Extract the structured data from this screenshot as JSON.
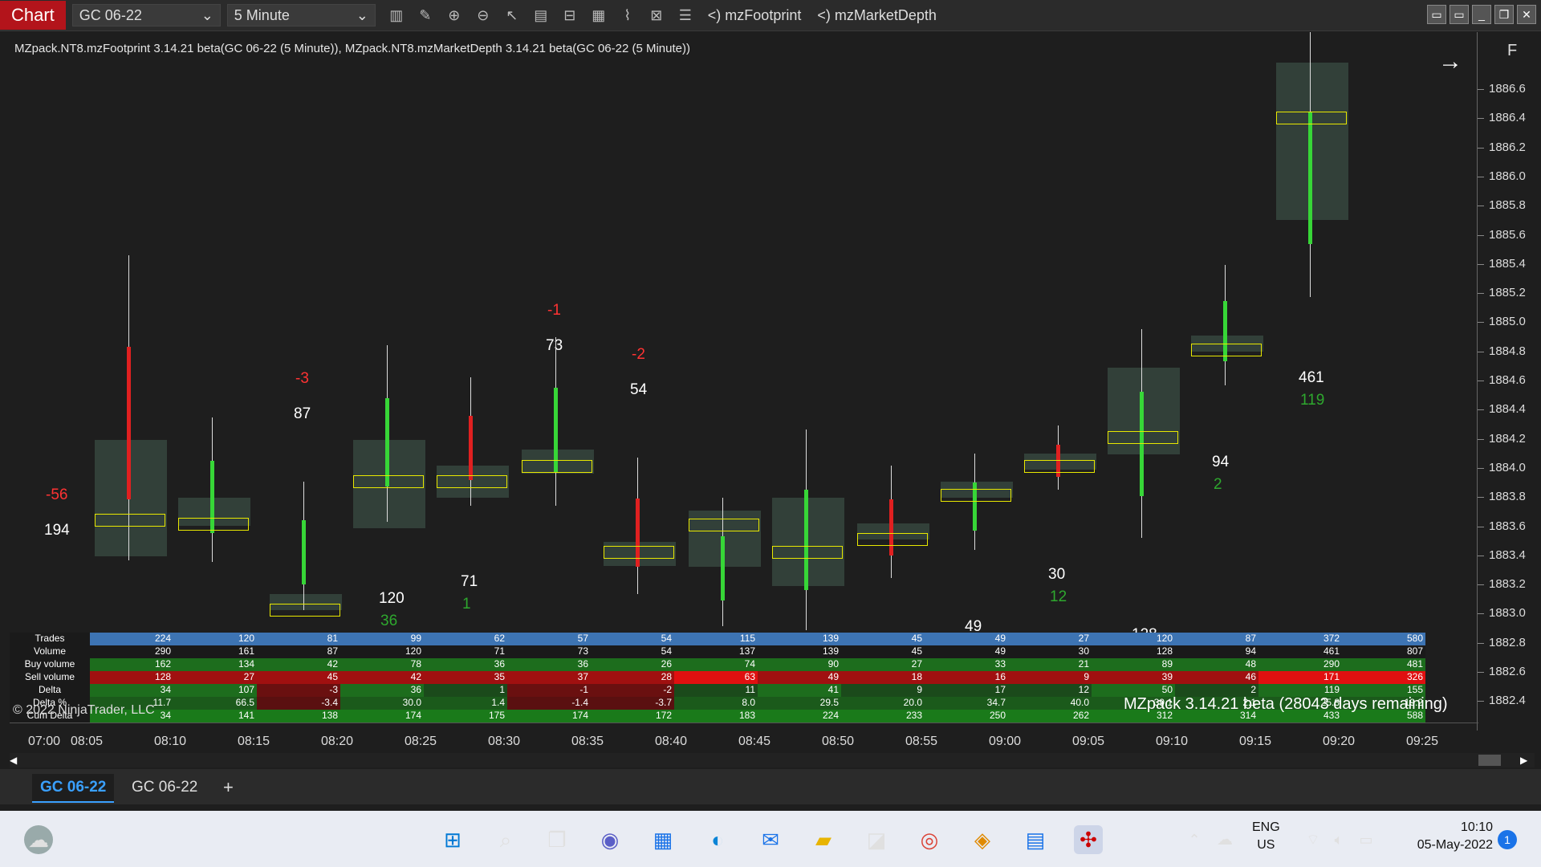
{
  "toolbar": {
    "chart_tab": "Chart",
    "instrument": "GC 06-22",
    "interval": "5 Minute",
    "indicator1": "<) mzFootprint",
    "indicator2": "<) mzMarketDepth"
  },
  "chart": {
    "title": "MZpack.NT8.mzFootprint 3.14.21 beta(GC 06-22 (5 Minute)), MZpack.NT8.mzMarketDepth 3.14.21 beta(GC 06-22 (5 Minute))",
    "f_label": "F",
    "price_ticks": [
      "1886.6",
      "1886.4",
      "1886.2",
      "1886.0",
      "1885.8",
      "1885.6",
      "1885.4",
      "1885.2",
      "1885.0",
      "1884.8",
      "1884.6",
      "1884.4",
      "1884.2",
      "1884.0",
      "1883.8",
      "1883.6",
      "1883.4",
      "1883.2",
      "1883.0",
      "1882.8",
      "1882.6",
      "1882.4"
    ],
    "time_ticks": [
      "07:00",
      "08:05",
      "08:10",
      "08:15",
      "08:20",
      "08:25",
      "08:30",
      "08:35",
      "08:40",
      "08:45",
      "08:50",
      "08:55",
      "09:00",
      "09:05",
      "09:10",
      "09:15",
      "09:20",
      "09:25"
    ],
    "watermark": "MZpack 3.14.21 beta  (28043 days remaining)",
    "copyright": "© 2022 NinjaTrader, LLC"
  },
  "stats": {
    "labels": [
      "Trades",
      "Volume",
      "Buy volume",
      "Sell volume",
      "Delta",
      "Delta %",
      "Cum Delta"
    ],
    "columns": [
      {
        "trades": "224",
        "volume": "290",
        "buy": "162",
        "sell": "128",
        "delta": "34",
        "deltapct": "11.7",
        "cum": "34"
      },
      {
        "trades": "120",
        "volume": "161",
        "buy": "134",
        "sell": "27",
        "delta": "107",
        "deltapct": "66.5",
        "cum": "141"
      },
      {
        "trades": "81",
        "volume": "87",
        "buy": "42",
        "sell": "45",
        "delta": "-3",
        "deltapct": "-3.4",
        "cum": "138"
      },
      {
        "trades": "99",
        "volume": "120",
        "buy": "78",
        "sell": "42",
        "delta": "36",
        "deltapct": "30.0",
        "cum": "174"
      },
      {
        "trades": "62",
        "volume": "71",
        "buy": "36",
        "sell": "35",
        "delta": "1",
        "deltapct": "1.4",
        "cum": "175"
      },
      {
        "trades": "57",
        "volume": "73",
        "buy": "36",
        "sell": "37",
        "delta": "-1",
        "deltapct": "-1.4",
        "cum": "174"
      },
      {
        "trades": "54",
        "volume": "54",
        "buy": "26",
        "sell": "28",
        "delta": "-2",
        "deltapct": "-3.7",
        "cum": "172"
      },
      {
        "trades": "115",
        "volume": "137",
        "buy": "74",
        "sell": "63",
        "delta": "11",
        "deltapct": "8.0",
        "cum": "183"
      },
      {
        "trades": "139",
        "volume": "139",
        "buy": "90",
        "sell": "49",
        "delta": "41",
        "deltapct": "29.5",
        "cum": "224"
      },
      {
        "trades": "45",
        "volume": "45",
        "buy": "27",
        "sell": "18",
        "delta": "9",
        "deltapct": "20.0",
        "cum": "233"
      },
      {
        "trades": "49",
        "volume": "49",
        "buy": "33",
        "sell": "16",
        "delta": "17",
        "deltapct": "34.7",
        "cum": "250"
      },
      {
        "trades": "27",
        "volume": "30",
        "buy": "21",
        "sell": "9",
        "delta": "12",
        "deltapct": "40.0",
        "cum": "262"
      },
      {
        "trades": "120",
        "volume": "128",
        "buy": "89",
        "sell": "39",
        "delta": "50",
        "deltapct": "39.1",
        "cum": "312"
      },
      {
        "trades": "87",
        "volume": "94",
        "buy": "48",
        "sell": "46",
        "delta": "2",
        "deltapct": "2.1",
        "cum": "314"
      },
      {
        "trades": "372",
        "volume": "461",
        "buy": "290",
        "sell": "171",
        "delta": "119",
        "deltapct": "25.8",
        "cum": "433"
      },
      {
        "trades": "580",
        "volume": "807",
        "buy": "481",
        "sell": "326",
        "delta": "155",
        "deltapct": "19.2",
        "cum": "588"
      }
    ]
  },
  "bars": [
    {
      "vol": "194",
      "delta": "-56"
    },
    {
      "vol": "161",
      "delta": ""
    },
    {
      "vol": "87",
      "delta": "-3"
    },
    {
      "vol": "120",
      "delta": "36"
    },
    {
      "vol": "71",
      "delta": "1"
    },
    {
      "vol": "73",
      "delta": "-1"
    },
    {
      "vol": "54",
      "delta": "-2"
    },
    {
      "vol": "137",
      "delta": ""
    },
    {
      "vol": "139",
      "delta": ""
    },
    {
      "vol": "45",
      "delta": "9"
    },
    {
      "vol": "49",
      "delta": ""
    },
    {
      "vol": "30",
      "delta": "12"
    },
    {
      "vol": "128",
      "delta": ""
    },
    {
      "vol": "94",
      "delta": "2"
    },
    {
      "vol": "461",
      "delta": "119"
    }
  ],
  "sheet_tabs": [
    "GC 06-22",
    "GC 06-22",
    "+"
  ],
  "taskbar": {
    "lang1": "ENG",
    "lang2": "US",
    "time": "10:10",
    "date": "05-May-2022",
    "notifications": "1"
  },
  "colors": {
    "accent": "#b3141b",
    "buy": "#2e8b2e",
    "sell": "#e01010",
    "highlight": "#ffff00"
  }
}
